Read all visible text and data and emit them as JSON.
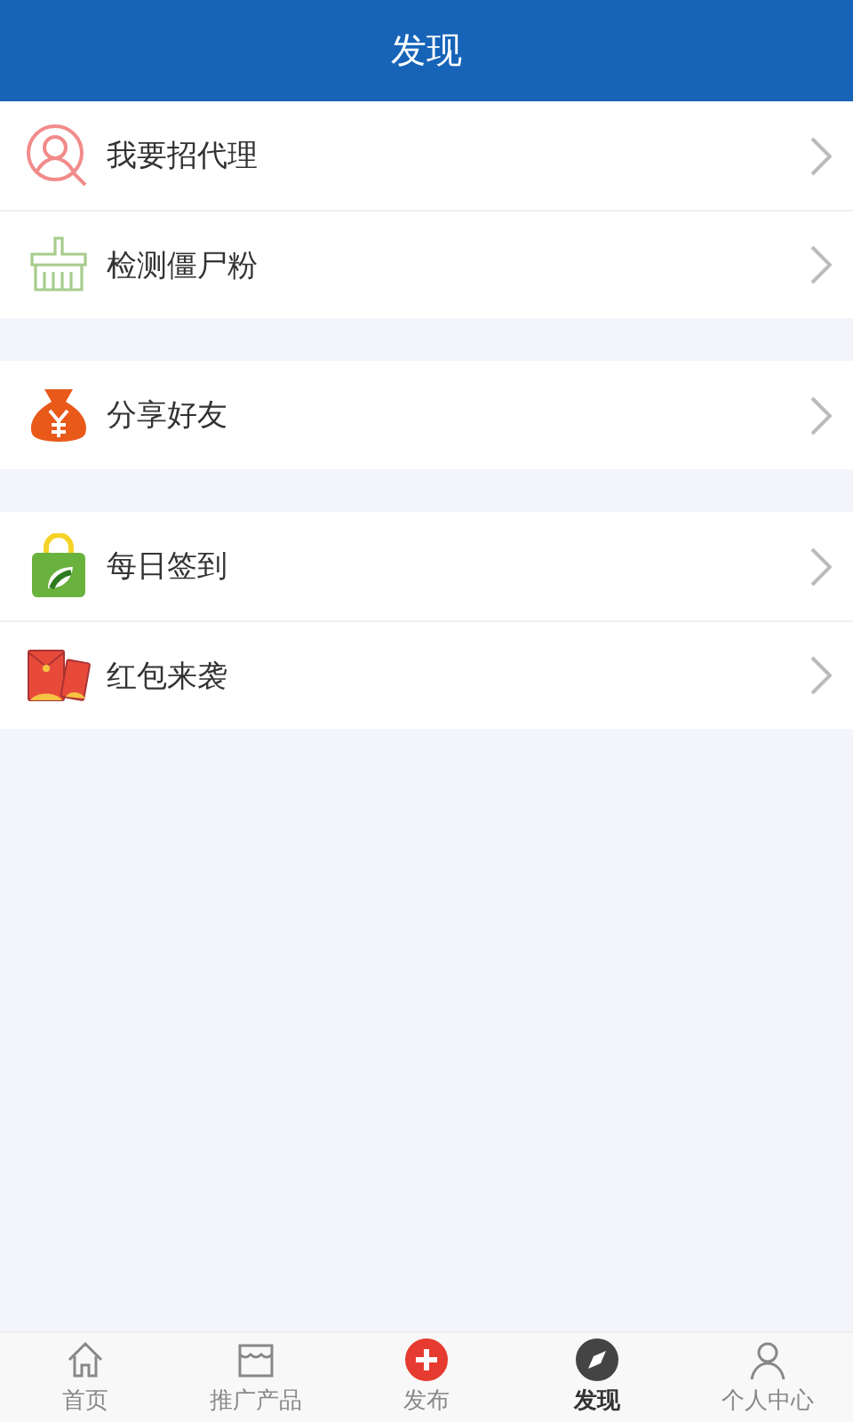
{
  "header": {
    "title": "发现"
  },
  "groups": [
    {
      "items": [
        {
          "kind": "agent",
          "label": "我要招代理"
        },
        {
          "kind": "detect",
          "label": "检测僵尸粉"
        }
      ]
    },
    {
      "items": [
        {
          "kind": "share",
          "label": "分享好友"
        }
      ]
    },
    {
      "items": [
        {
          "kind": "checkin",
          "label": "每日签到"
        },
        {
          "kind": "redpacket",
          "label": "红包来袭"
        }
      ]
    }
  ],
  "tabs": [
    {
      "kind": "home",
      "label": "首页",
      "selected": false
    },
    {
      "kind": "store",
      "label": "推广产品",
      "selected": false
    },
    {
      "kind": "publish",
      "label": "发布",
      "selected": false
    },
    {
      "kind": "discover",
      "label": "发现",
      "selected": true
    },
    {
      "kind": "profile",
      "label": "个人中心",
      "selected": false
    }
  ]
}
